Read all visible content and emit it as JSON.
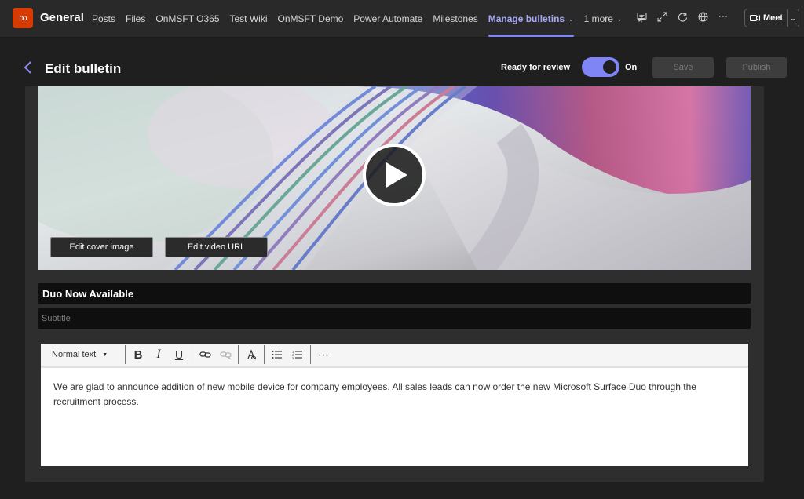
{
  "topbar": {
    "team_initials": "oo",
    "channel": "General",
    "tabs": [
      {
        "label": "Posts"
      },
      {
        "label": "Files"
      },
      {
        "label": "OnMSFT O365"
      },
      {
        "label": "Test Wiki"
      },
      {
        "label": "OnMSFT Demo"
      },
      {
        "label": "Power Automate"
      },
      {
        "label": "Milestones"
      },
      {
        "label": "Manage bulletins",
        "active": true
      }
    ],
    "more_label": "1 more",
    "meet_label": "Meet"
  },
  "header": {
    "title": "Edit bulletin",
    "review_label": "Ready for review",
    "toggle_state": "On",
    "save_label": "Save",
    "publish_label": "Publish"
  },
  "cover": {
    "edit_cover_label": "Edit cover image",
    "edit_video_label": "Edit video URL"
  },
  "form": {
    "title_value": "Duo Now Available",
    "subtitle_placeholder": "Subtitle"
  },
  "editor": {
    "format_select": "Normal text",
    "body": "We are glad to announce addition of new mobile device for company employees. All sales leads can now order the new Microsoft Surface Duo through the recruitment process."
  },
  "colors": {
    "accent": "#7f85f5",
    "team_icon": "#d83b01",
    "background": "#1f1f1f",
    "panel": "#2e2e2e"
  },
  "icons": [
    "chat-icon",
    "expand-icon",
    "refresh-icon",
    "globe-icon",
    "more-icon",
    "video-camera-icon",
    "back-arrow-icon",
    "play-icon",
    "bold-icon",
    "italic-icon",
    "underline-icon",
    "link-icon",
    "unlink-icon",
    "clear-format-icon",
    "bullet-list-icon",
    "numbered-list-icon",
    "ellipsis-icon"
  ]
}
